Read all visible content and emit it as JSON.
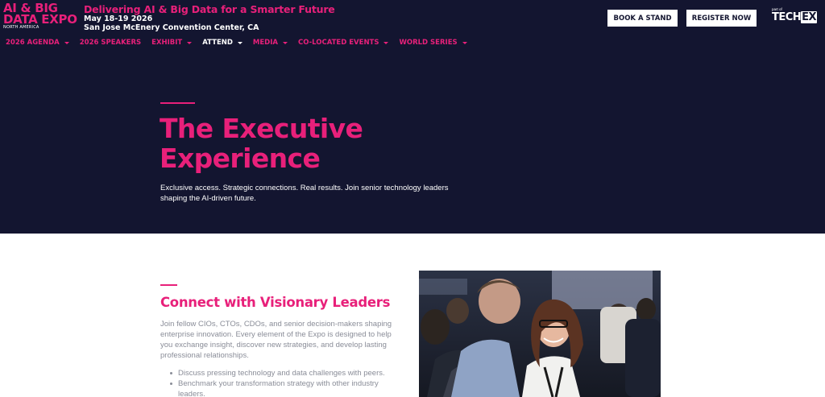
{
  "header": {
    "logo": {
      "line1": "AI & BIG",
      "line2": "DATA EXPO",
      "line3": "NORTH AMERICA"
    },
    "tagline": "Delivering AI & Big Data for a Smarter Future",
    "date": "May 18-19 2026",
    "venue": "San Jose McEnery Convention Center, CA",
    "book_label": "BOOK A STAND",
    "register_label": "REGISTER NOW",
    "partner": {
      "part_of": "part of",
      "name_main": "TECH",
      "name_tail": "EX"
    }
  },
  "nav": {
    "items": [
      {
        "label": "2026 AGENDA",
        "has_dropdown": true,
        "active": false
      },
      {
        "label": "2026 SPEAKERS",
        "has_dropdown": false,
        "active": false
      },
      {
        "label": "EXHIBIT",
        "has_dropdown": true,
        "active": false
      },
      {
        "label": "ATTEND",
        "has_dropdown": true,
        "active": true
      },
      {
        "label": "MEDIA",
        "has_dropdown": true,
        "active": false
      },
      {
        "label": "CO-LOCATED EVENTS",
        "has_dropdown": true,
        "active": false
      },
      {
        "label": "WORLD SERIES",
        "has_dropdown": true,
        "active": false
      }
    ]
  },
  "hero": {
    "title_line1": "The Executive",
    "title_line2": "Experience",
    "subtitle_line1": "Exclusive access. Strategic connections. Real results. Join senior technology leaders",
    "subtitle_line2": "shaping the AI-driven future."
  },
  "section": {
    "title": "Connect with Visionary Leaders",
    "body_lines": [
      "Join fellow CIOs, CTOs, CDOs, and senior decision-makers shaping",
      "enterprise innovation. Every element of the Expo is designed to help",
      "you exchange insight, discover new strategies, and develop lasting",
      "professional relationships."
    ],
    "bullets": [
      "Discuss pressing technology and data challenges with peers.",
      "Benchmark your transformation strategy with other industry leaders."
    ]
  },
  "colors": {
    "brand_pink": "#e8207a",
    "navy_background": "#131530",
    "body_text": "#8a8d98"
  }
}
